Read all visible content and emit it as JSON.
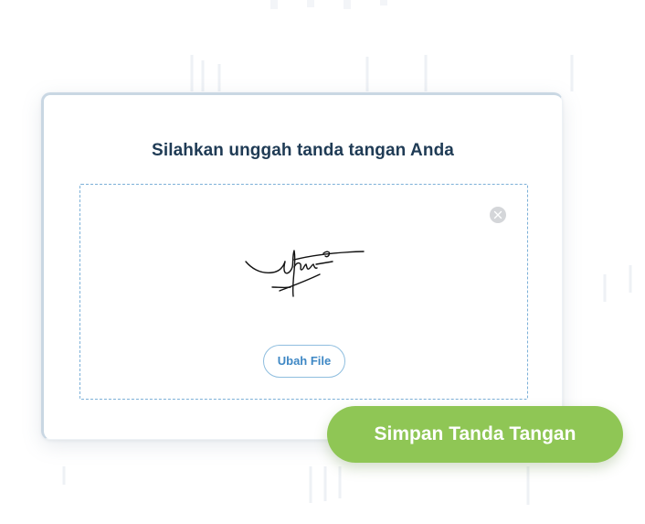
{
  "card": {
    "title": "Silahkan unggah tanda tangan Anda"
  },
  "dropzone": {
    "remove_icon": "close-circle-icon",
    "signature_image": "handwritten-signature",
    "change_file_label": "Ubah File"
  },
  "actions": {
    "save_label": "Simpan Tanda Tangan"
  },
  "colors": {
    "title": "#1f3b55",
    "dashed_border": "#7cb0d8",
    "change_file_text": "#3f88c5",
    "save_button": "#8fc655",
    "remove_icon_bg": "#d4d6d9"
  }
}
